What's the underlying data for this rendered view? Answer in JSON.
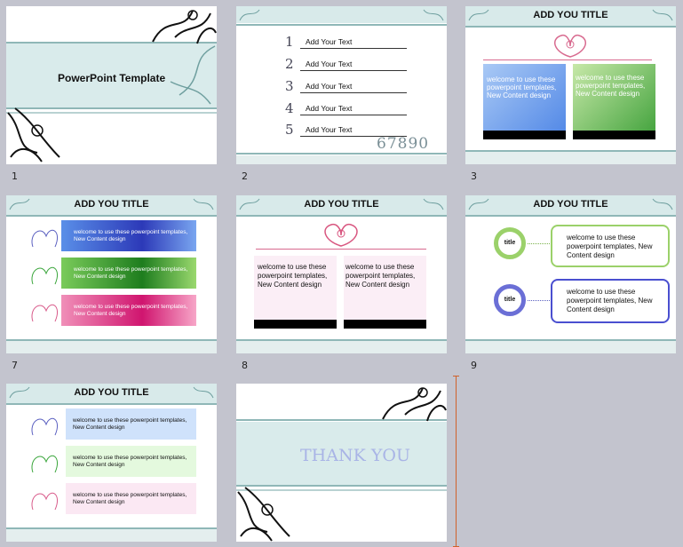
{
  "slides": [
    {
      "number": "1",
      "title": "PowerPoint Template"
    },
    {
      "number": "2",
      "items": [
        "Add Your Text",
        "Add Your Text",
        "Add Your Text",
        "Add Your Text",
        "Add Your Text"
      ],
      "digits": [
        "1",
        "2",
        "3",
        "4",
        "5"
      ],
      "deco_digits": "67890"
    },
    {
      "number": "3",
      "title": "ADD YOU TITLE",
      "box_text": "welcome to use these powerpoint templates, New Content design"
    },
    {
      "number": "7",
      "title": "ADD YOU TITLE",
      "bar_text": "welcome to use these powerpoint templates, New Content design"
    },
    {
      "number": "8",
      "title": "ADD YOU TITLE",
      "box_text": "welcome to use these powerpoint templates, New Content design"
    },
    {
      "number": "9",
      "title": "ADD YOU TITLE",
      "ring_label": "title",
      "box_text": "welcome to use these powerpoint templates, New Content design"
    },
    {
      "number": "",
      "title": "ADD YOU TITLE",
      "bar_text": "welcome to use these powerpoint templates, New Content design"
    },
    {
      "number": "",
      "title": "THANK YOU"
    }
  ]
}
